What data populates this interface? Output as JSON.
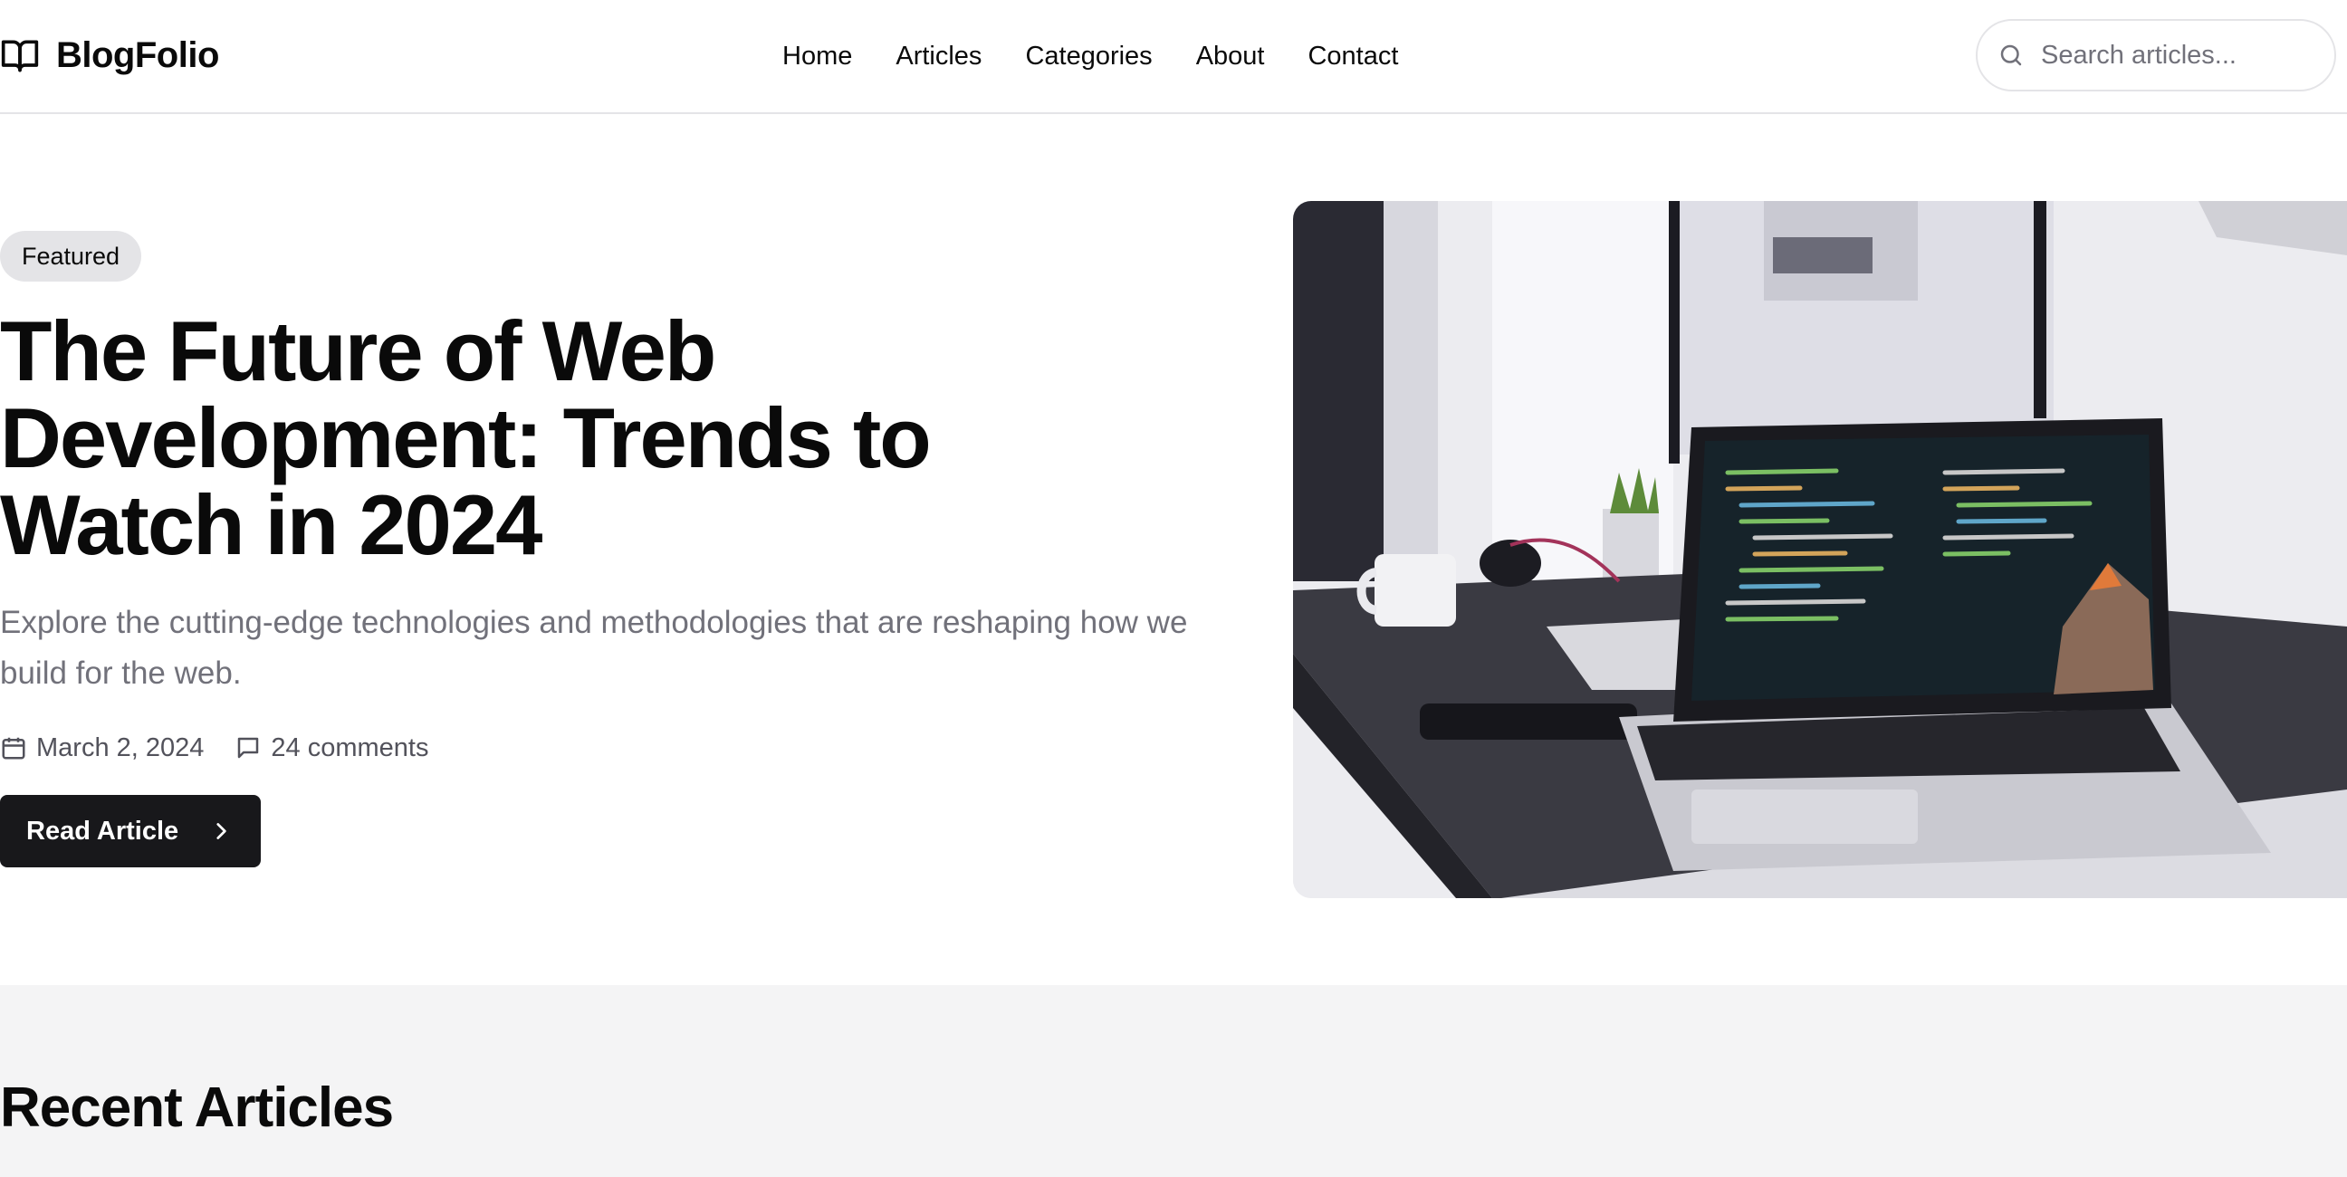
{
  "header": {
    "brand": "BlogFolio",
    "brand_icon": "open-book-icon",
    "nav": [
      "Home",
      "Articles",
      "Categories",
      "About",
      "Contact"
    ],
    "search": {
      "placeholder": "Search articles...",
      "value": "",
      "icon": "search-icon"
    }
  },
  "hero": {
    "badge": "Featured",
    "title": "The Future of Web Development: Trends to Watch in 2024",
    "description": "Explore the cutting-edge technologies and methodologies that are reshaping how we build for the web.",
    "date": "March 2, 2024",
    "comments": "24 comments",
    "button": "Read Article",
    "image_subject": "laptop with code editor on a desk"
  },
  "recent": {
    "title": "Recent Articles"
  },
  "colors": {
    "primary": "#18181b",
    "muted_text": "#71717a",
    "border": "#e4e4e7",
    "section_bg": "#f4f4f5"
  }
}
